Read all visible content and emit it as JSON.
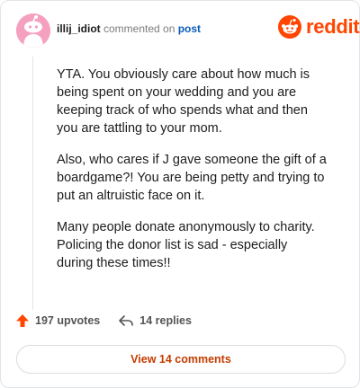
{
  "header": {
    "username": "illij_idiot",
    "action_text": " commented on ",
    "post_link": "post"
  },
  "logo": {
    "text": "reddit",
    "icon": "reddit-alien-icon",
    "color": "#ff4500"
  },
  "comment": {
    "paragraphs": [
      "YTA. You obviously care about how much is being spent on your wedding and you are keeping track of who spends what and then you are tattling to your mom.",
      "Also, who cares if J gave someone the gift of a boardgame?! You are being petty and trying to put an altruistic face on it.",
      "Many people donate anonymously to charity. Policing the donor list is sad - especially during these times!!"
    ]
  },
  "actions": {
    "upvotes": "197 upvotes",
    "replies": "14 replies"
  },
  "view_button": {
    "label": "View 14 comments",
    "color": "#c43c00"
  },
  "colors": {
    "post_link": "#0a5cb8",
    "avatar_bg": "#f6a0bf",
    "upvote_arrow": "#ff4500"
  }
}
